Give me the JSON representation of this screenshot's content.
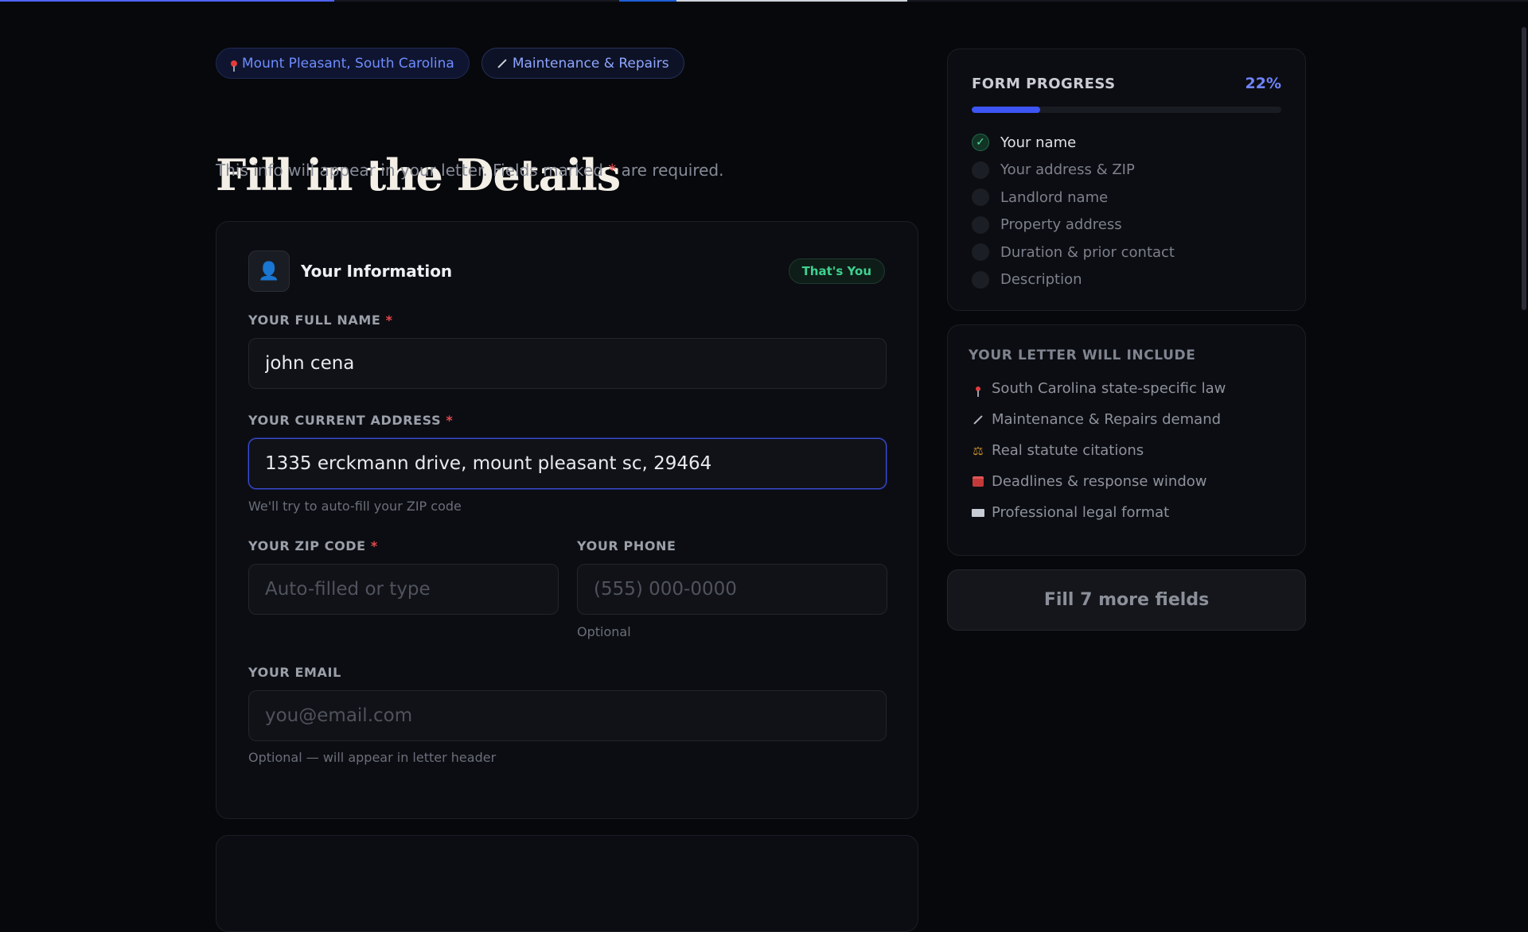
{
  "top_progress": {
    "label": "page progress"
  },
  "pills": {
    "location": "Mount Pleasant, South Carolina",
    "service": "Maintenance & Repairs"
  },
  "header": {
    "title": "Fill in the Details",
    "subtitle_pre": "This info will appear in your letter. Fields marked ",
    "subtitle_star": "*",
    "subtitle_post": " are required."
  },
  "section": {
    "title": "Your Information",
    "badge": "That's You",
    "fields": {
      "full_name": {
        "label": "YOUR FULL NAME",
        "required": "*",
        "value": "john cena",
        "placeholder": ""
      },
      "address": {
        "label": "YOUR CURRENT ADDRESS",
        "required": "*",
        "value": "1335 erckmann drive, mount pleasant sc, 29464",
        "hint": "We'll try to auto-fill your ZIP code"
      },
      "zip": {
        "label": "YOUR ZIP CODE",
        "required": "*",
        "value": "",
        "placeholder": "Auto-filled or type"
      },
      "phone": {
        "label": "YOUR PHONE",
        "value": "",
        "placeholder": "(555) 000-0000",
        "hint": "Optional"
      },
      "email": {
        "label": "YOUR EMAIL",
        "value": "",
        "placeholder": "you@email.com",
        "hint": "Optional — will appear in letter header"
      }
    }
  },
  "progress": {
    "title": "FORM PROGRESS",
    "percent_text": "22%",
    "percent": 22,
    "accent": "#3d55f5",
    "steps": [
      {
        "label": "Your name",
        "done": true,
        "check": "✓"
      },
      {
        "label": "Your address & ZIP",
        "done": false
      },
      {
        "label": "Landlord name",
        "done": false
      },
      {
        "label": "Property address",
        "done": false
      },
      {
        "label": "Duration & prior contact",
        "done": false
      },
      {
        "label": "Description",
        "done": false
      }
    ]
  },
  "includes": {
    "title": "YOUR LETTER WILL INCLUDE",
    "items": [
      {
        "label": "South Carolina state-specific law",
        "icon": "pin-icon"
      },
      {
        "label": "Maintenance & Repairs demand",
        "icon": "wand-icon"
      },
      {
        "label": "Real statute citations",
        "icon": "scale-icon"
      },
      {
        "label": "Deadlines & response window",
        "icon": "calendar-icon"
      },
      {
        "label": "Professional legal format",
        "icon": "envelope-icon"
      }
    ]
  },
  "cta": {
    "label": "Fill 7 more fields"
  }
}
